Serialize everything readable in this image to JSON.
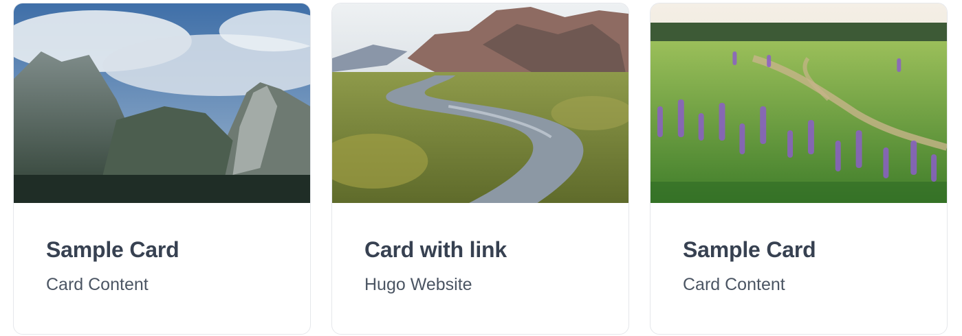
{
  "cards": [
    {
      "title": "Sample Card",
      "content": "Card Content",
      "image": "mountain-clouds-image",
      "is_link": false
    },
    {
      "title": "Card with link",
      "content": "Hugo Website",
      "image": "stream-valley-image",
      "is_link": true
    },
    {
      "title": "Sample Card",
      "content": "Card Content",
      "image": "lupine-meadow-image",
      "is_link": false
    }
  ]
}
